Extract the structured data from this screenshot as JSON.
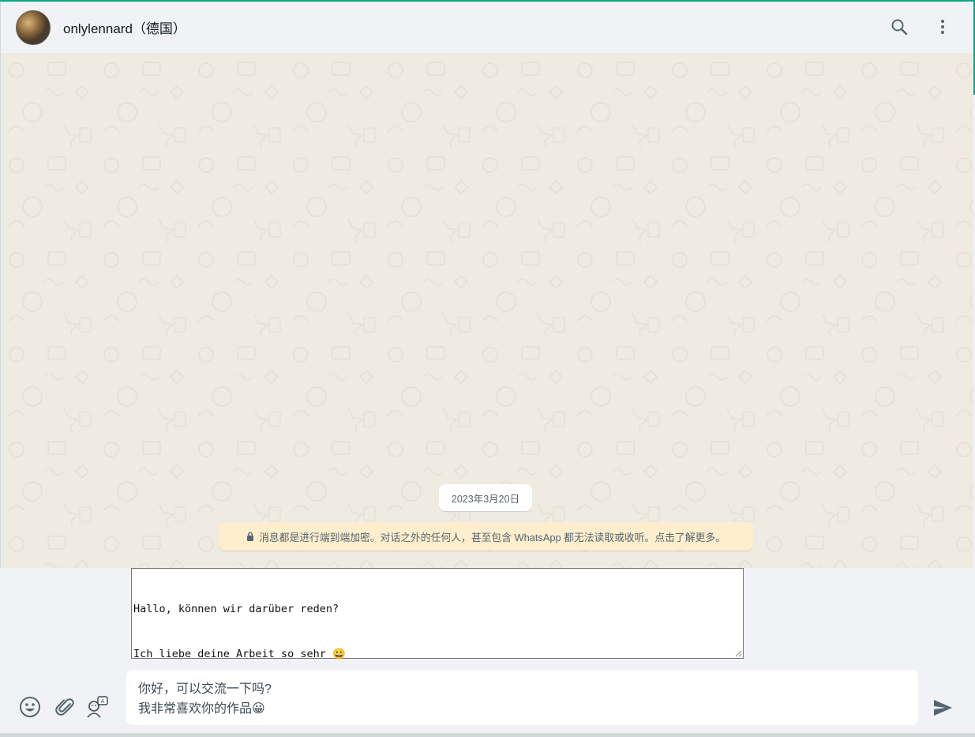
{
  "header": {
    "contact_name": "onlylennard（德国）",
    "avatar_icon": "contact-avatar",
    "search_icon": "search-icon",
    "menu_icon": "kebab-menu-icon"
  },
  "chat": {
    "date_label": "2023年3月20日",
    "encryption_notice": "消息都是进行端到端加密。对话之外的任何人，甚至包含 WhatsApp 都无法读取或收听。点击了解更多。"
  },
  "translation_box": {
    "line1": "Hallo, können wir darüber reden?",
    "line2": "Ich liebe deine Arbeit so sehr 😀"
  },
  "composer": {
    "line1": "你好，可以交流一下吗?",
    "line2": "我非常喜欢你的作品😀",
    "emoji_icon": "emoji-icon",
    "attach_icon": "paperclip-icon",
    "translate_icon": "translate-icon",
    "send_icon": "send-icon"
  },
  "colors": {
    "accent": "#00a884",
    "chat_bg": "#efeae2",
    "panel_bg": "#f0f2f5",
    "notice_bg": "#ffeecd",
    "icon": "#54656f"
  }
}
